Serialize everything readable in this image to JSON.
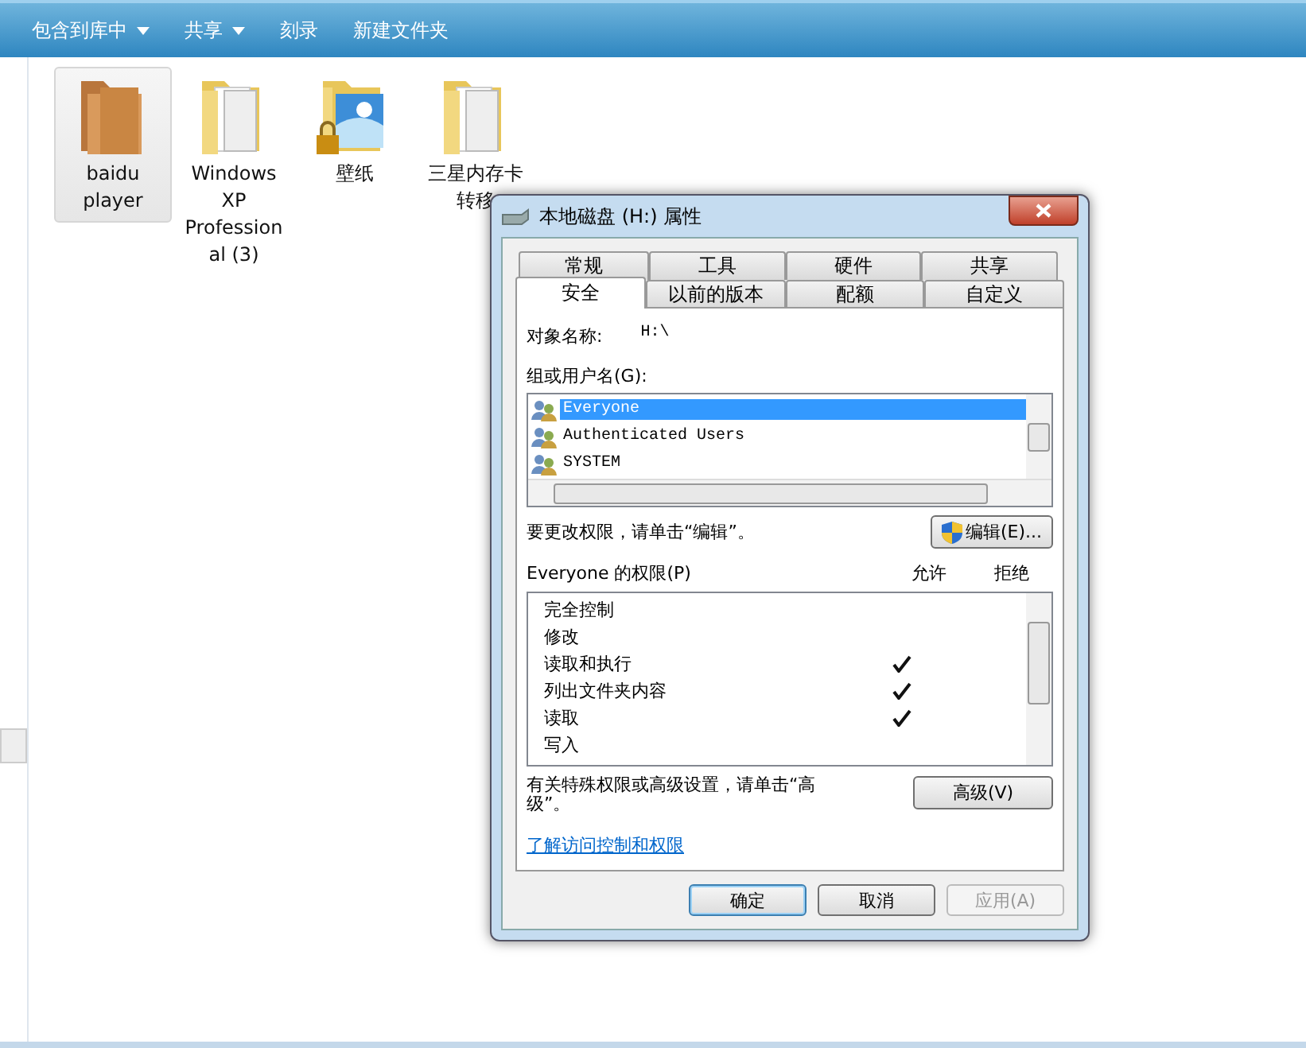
{
  "toolbar": [
    {
      "label": "包含到库中",
      "dropdown": true
    },
    {
      "label": "共享",
      "dropdown": true
    },
    {
      "label": "刻录",
      "dropdown": false
    },
    {
      "label": "新建文件夹",
      "dropdown": false
    }
  ],
  "files": [
    {
      "name": "baidu player",
      "kind": "brown",
      "selected": true
    },
    {
      "name": "Windows XP Profession al (3)",
      "kind": "docs",
      "selected": false
    },
    {
      "name": "壁纸",
      "kind": "locked",
      "selected": false
    },
    {
      "name": "三星内存卡转移",
      "kind": "docs",
      "selected": false
    }
  ],
  "dialog": {
    "title": "本地磁盘 (H:) 属性",
    "tab_rows": [
      [
        {
          "label": "常规",
          "selected": false
        },
        {
          "label": "工具",
          "selected": false
        },
        {
          "label": "硬件",
          "selected": false
        },
        {
          "label": "共享",
          "selected": false
        }
      ],
      [
        {
          "label": "安全",
          "selected": true
        },
        {
          "label": "以前的版本",
          "selected": false
        },
        {
          "label": "配额",
          "selected": false
        },
        {
          "label": "自定义",
          "selected": false
        }
      ]
    ],
    "object_label": "对象名称:",
    "object_value": "H:\\",
    "users_label": "组或用户名(G):",
    "users": [
      {
        "name": "Everyone",
        "selected": true
      },
      {
        "name": "Authenticated Users",
        "selected": false
      },
      {
        "name": "SYSTEM",
        "selected": false
      }
    ],
    "edit_hint": "要更改权限，请单击“编辑”。",
    "edit_button": "编辑(E)...",
    "perm_title": "Everyone 的权限(P)",
    "allow_header": "允许",
    "deny_header": "拒绝",
    "permissions": [
      {
        "name": "完全控制",
        "allow": false,
        "deny": false
      },
      {
        "name": "修改",
        "allow": false,
        "deny": false
      },
      {
        "name": "读取和执行",
        "allow": true,
        "deny": false
      },
      {
        "name": "列出文件夹内容",
        "allow": true,
        "deny": false
      },
      {
        "name": "读取",
        "allow": true,
        "deny": false
      },
      {
        "name": "写入",
        "allow": false,
        "deny": false
      }
    ],
    "advanced_hint": "有关特殊权限或高级设置，请单击“高级”。",
    "advanced_button": "高级(V)",
    "link": "了解访问控制和权限",
    "buttons": [
      {
        "label": "确定",
        "disabled": false,
        "default": true
      },
      {
        "label": "取消",
        "disabled": false,
        "default": false
      },
      {
        "label": "应用(A)",
        "disabled": true,
        "default": false
      }
    ]
  }
}
